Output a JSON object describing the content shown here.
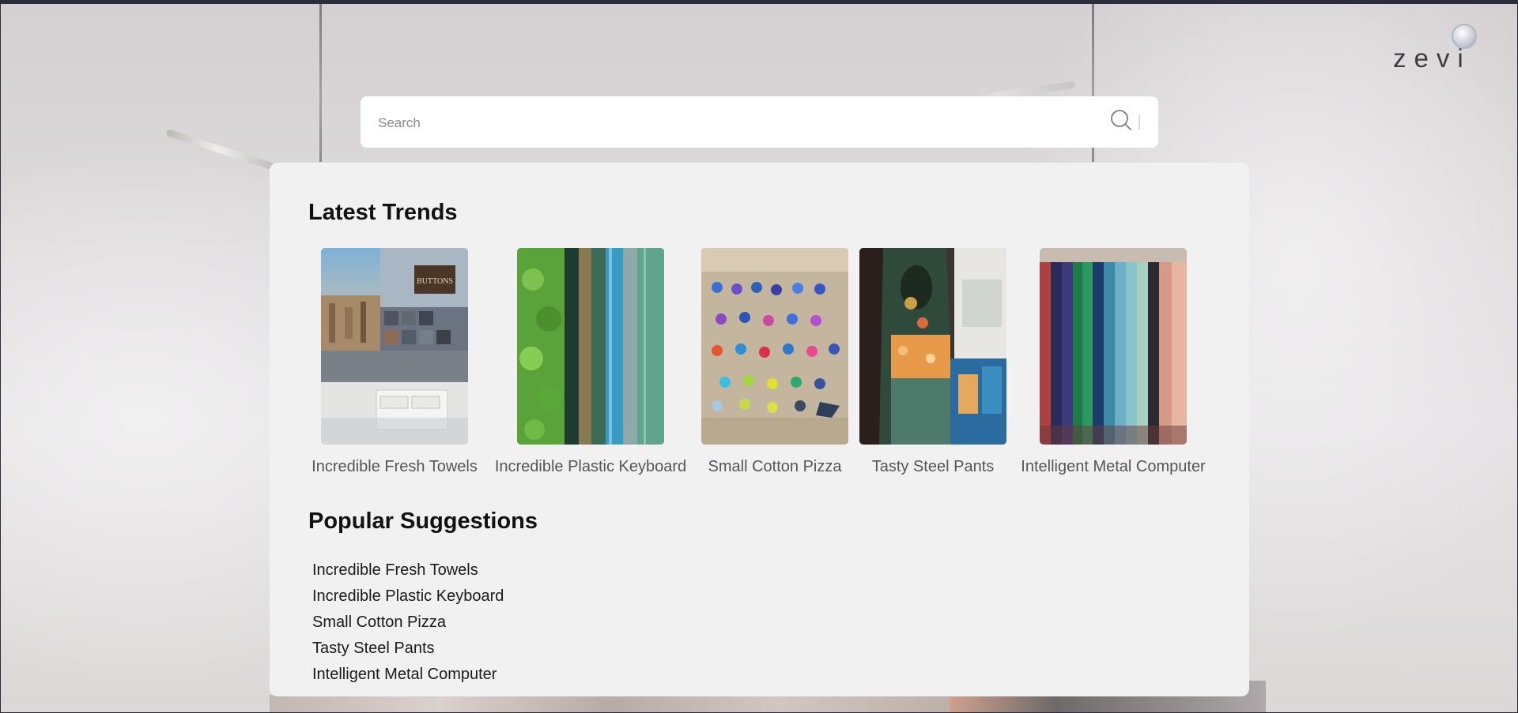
{
  "brand": {
    "logo_text": "zevi"
  },
  "search": {
    "placeholder": "Search",
    "value": ""
  },
  "latest_trends": {
    "title": "Latest Trends",
    "items": [
      {
        "label": "Incredible Fresh Towels",
        "image": "buttons-shop-photo"
      },
      {
        "label": "Incredible Plastic Keyboard",
        "image": "green-blue-fabric-rolls-photo"
      },
      {
        "label": "Small Cotton Pizza",
        "image": "beach-umbrellas-aerial-photo"
      },
      {
        "label": "Tasty Steel Pants",
        "image": "embroidered-dresses-photo"
      },
      {
        "label": "Intelligent Metal Computer",
        "image": "hanging-fabric-bolts-photo"
      }
    ]
  },
  "popular_suggestions": {
    "title": "Popular Suggestions",
    "items": [
      "Incredible Fresh Towels",
      "Incredible Plastic Keyboard",
      "Small Cotton Pizza",
      "Tasty Steel Pants",
      "Intelligent Metal Computer"
    ]
  },
  "colors": {
    "top_border": "#2b2d3a",
    "panel_bg": "#f1f1f1",
    "search_bg": "#ffffff"
  }
}
